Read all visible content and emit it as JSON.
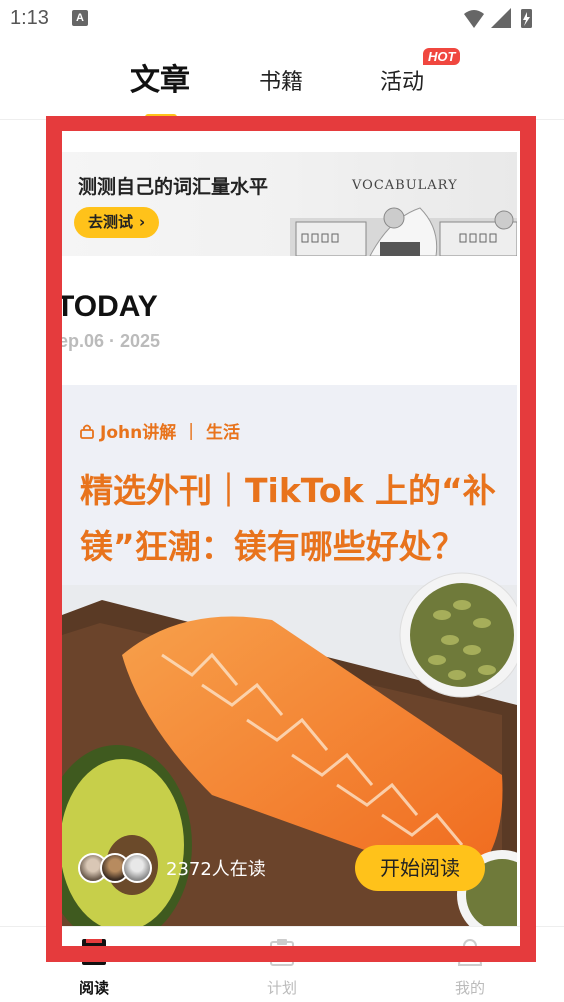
{
  "status_bar": {
    "time": "1:13",
    "notification_letter": "A"
  },
  "tabs": [
    {
      "label": "文章",
      "active": true
    },
    {
      "label": "书籍",
      "active": false
    },
    {
      "label": "活动",
      "active": false,
      "badge": "HOT"
    }
  ],
  "banner": {
    "title": "测测自己的词汇量水平",
    "button_label": "去测试",
    "image_word": "VOCABULARY"
  },
  "today": {
    "label": "TODAY",
    "date": "ep.06 · 2025"
  },
  "article": {
    "author": "John讲解",
    "category": "生活",
    "title": "精选外刊｜TikTok 上的“补镁”狂潮：镁有哪些好处？",
    "readers": "2372人在读",
    "start_button": "开始阅读"
  },
  "bottom_nav": [
    {
      "label": "阅读",
      "icon": "book-icon",
      "active": true
    },
    {
      "label": "计划",
      "icon": "clipboard-icon",
      "active": false
    },
    {
      "label": "我的",
      "icon": "person-icon",
      "active": false
    }
  ],
  "colors": {
    "accent": "#ffc21a",
    "title_orange": "#e8731c",
    "highlight_frame": "#e53b3d",
    "hot_badge": "#f0473f"
  }
}
